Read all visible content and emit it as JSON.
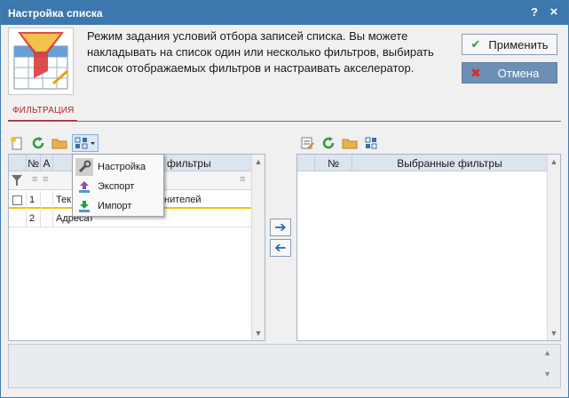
{
  "window": {
    "title": "Настройка списка",
    "help_label": "?",
    "close_label": "×"
  },
  "header": {
    "description": "Режим задания условий отбора записей списка. Вы можете накладывать на список один или несколько фильтров, выбирать список отображаемых фильтров и настраивать акселератор.",
    "apply_label": "Применить",
    "cancel_label": "Отмена"
  },
  "tabs": {
    "active": "ФИЛЬТРАЦИЯ"
  },
  "left_grid": {
    "columns": [
      "№",
      "А",
      "фильтры"
    ],
    "rows": [
      {
        "num": "1",
        "name": "Тек",
        "name_tail": "нителей"
      },
      {
        "num": "2",
        "name": "Адресат",
        "name_tail": ""
      }
    ]
  },
  "context_menu": {
    "items": [
      {
        "label": "Настройка",
        "icon": "wrench-icon"
      },
      {
        "label": "Экспорт",
        "icon": "export-icon"
      },
      {
        "label": "Импорт",
        "icon": "import-icon"
      }
    ]
  },
  "right_grid": {
    "columns": [
      "№",
      "Выбранные фильтры"
    ]
  },
  "colors": {
    "titlebar": "#3c78ad",
    "tab_accent": "#b0282c",
    "row_highlight_line": "#f2c200"
  }
}
